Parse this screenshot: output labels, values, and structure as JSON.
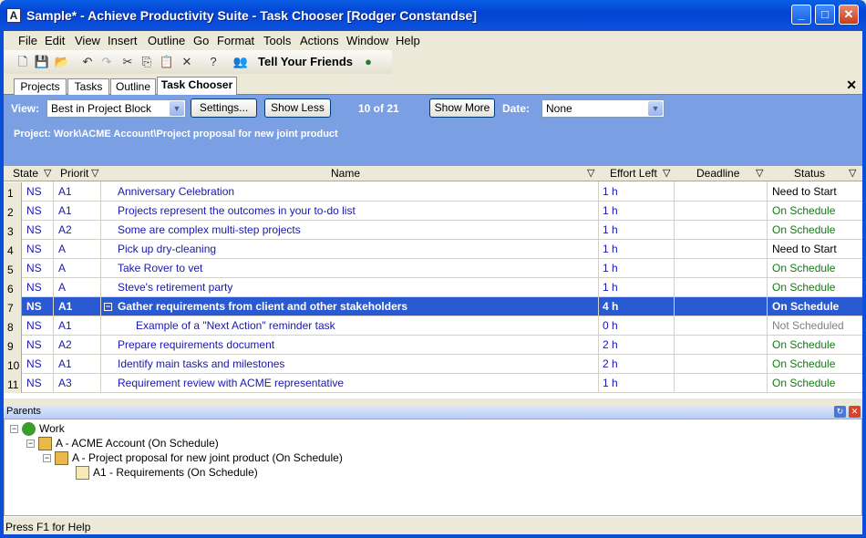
{
  "window": {
    "title": "Sample* - Achieve Productivity Suite - Task Chooser [Rodger Constandse]"
  },
  "menu": [
    "File",
    "Edit",
    "View",
    "Insert",
    "Outline",
    "Go",
    "Format",
    "Tools",
    "Actions",
    "Window",
    "Help"
  ],
  "toolbar": {
    "tell_friends": "Tell Your Friends"
  },
  "tabs": [
    "Projects",
    "Tasks",
    "Outline",
    "Task Chooser"
  ],
  "chooser": {
    "view_label": "View:",
    "view_value": "Best in Project Block",
    "settings_label": "Settings...",
    "show_less_label": "Show Less",
    "count": "10 of 21",
    "show_more_label": "Show More",
    "date_label": "Date:",
    "date_value": "None",
    "project_line": "Project: Work\\ACME Account\\Project proposal for new joint product"
  },
  "grid": {
    "columns": [
      "State",
      "Priorit",
      "Name",
      "Effort Left",
      "Deadline",
      "Status"
    ],
    "rows": [
      {
        "num": "1",
        "state": "NS",
        "priority": "A1",
        "name": "Anniversary Celebration",
        "effort": "1 h",
        "deadline": "",
        "status": "Need to Start"
      },
      {
        "num": "2",
        "state": "NS",
        "priority": "A1",
        "name": "Projects represent the outcomes in your to-do list",
        "effort": "1 h",
        "deadline": "",
        "status": "On Schedule"
      },
      {
        "num": "3",
        "state": "NS",
        "priority": "A2",
        "name": "Some are complex multi-step projects",
        "effort": "1 h",
        "deadline": "",
        "status": "On Schedule"
      },
      {
        "num": "4",
        "state": "NS",
        "priority": "A",
        "name": "Pick up dry-cleaning",
        "effort": "1 h",
        "deadline": "",
        "status": "Need to Start"
      },
      {
        "num": "5",
        "state": "NS",
        "priority": "A",
        "name": "Take Rover to vet",
        "effort": "1 h",
        "deadline": "",
        "status": "On Schedule"
      },
      {
        "num": "6",
        "state": "NS",
        "priority": "A",
        "name": "Steve's retirement party",
        "effort": "1 h",
        "deadline": "",
        "status": "On Schedule"
      },
      {
        "num": "7",
        "state": "NS",
        "priority": "A1",
        "name": "Gather requirements from client and other stakeholders",
        "effort": "4 h",
        "deadline": "",
        "status": "On Schedule"
      },
      {
        "num": "8",
        "state": "NS",
        "priority": "A1",
        "name": "Example of a \"Next Action\" reminder task",
        "effort": "0 h",
        "deadline": "",
        "status": "Not Scheduled"
      },
      {
        "num": "9",
        "state": "NS",
        "priority": "A2",
        "name": "Prepare requirements document",
        "effort": "2 h",
        "deadline": "",
        "status": "On Schedule"
      },
      {
        "num": "10",
        "state": "NS",
        "priority": "A1",
        "name": "Identify main tasks and milestones",
        "effort": "2 h",
        "deadline": "",
        "status": "On Schedule"
      },
      {
        "num": "11",
        "state": "NS",
        "priority": "A3",
        "name": "Requirement review with ACME representative",
        "effort": "1 h",
        "deadline": "",
        "status": "On Schedule"
      }
    ]
  },
  "parents": {
    "title": "Parents",
    "tree": [
      "Work",
      "A - ACME Account (On Schedule)",
      "A - Project proposal for new joint product (On Schedule)",
      "A1 - Requirements (On Schedule)"
    ]
  },
  "statusbar": {
    "text": "Press F1 for Help"
  }
}
